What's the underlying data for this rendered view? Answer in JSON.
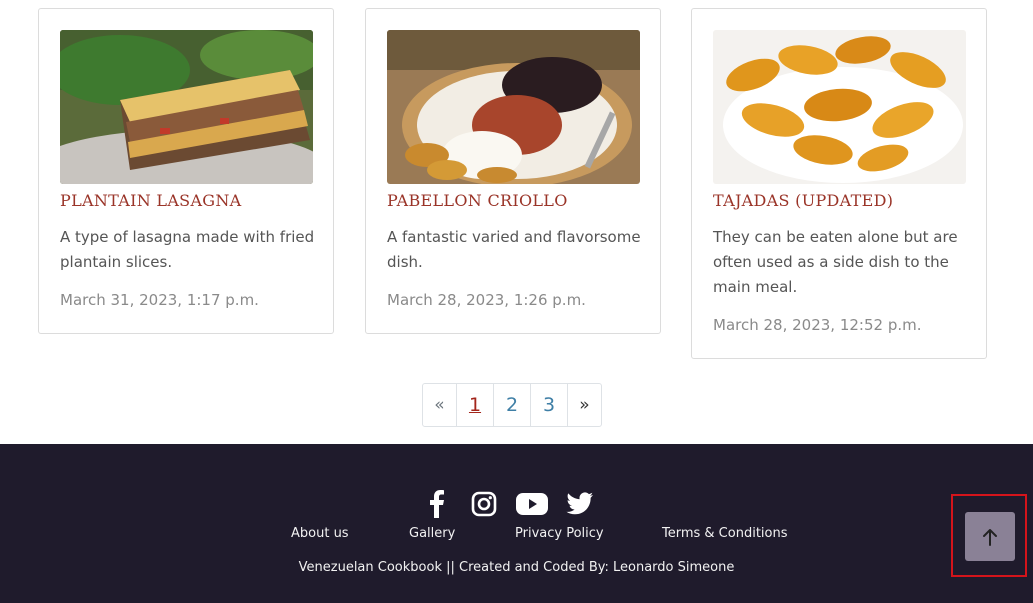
{
  "cards": [
    {
      "title": "PLANTAIN LASAGNA",
      "description": "A type of lasagna made with fried plantain slices.",
      "date": "March 31, 2023, 1:17 p.m."
    },
    {
      "title": "PABELLON CRIOLLO",
      "description": "A fantastic varied and flavorsome dish.",
      "date": "March 28, 2023, 1:26 p.m."
    },
    {
      "title": "TAJADAS (UPDATED)",
      "description": "They can be eaten alone but are often used as a side dish to the main meal.",
      "date": "March 28, 2023, 12:52 p.m."
    }
  ],
  "pagination": {
    "prev": "«",
    "pages": [
      "1",
      "2",
      "3"
    ],
    "current": "1",
    "next": "»"
  },
  "footer": {
    "social_icons": [
      "facebook-icon",
      "instagram-icon",
      "youtube-icon",
      "twitter-icon"
    ],
    "links": {
      "about": "About us",
      "gallery": "Gallery",
      "privacy": "Privacy Policy",
      "terms": "Terms & Conditions"
    },
    "copyright": "Venezuelan Cookbook || Created and Coded By: Leonardo Simeone"
  },
  "back_to_top": {
    "icon": "arrow-up-icon"
  },
  "colors": {
    "title": "#9a3428",
    "footer_bg": "#1f1b2c",
    "link": "#3f7fa6",
    "active_page": "#a3261c",
    "top_button": "#8a8196"
  }
}
